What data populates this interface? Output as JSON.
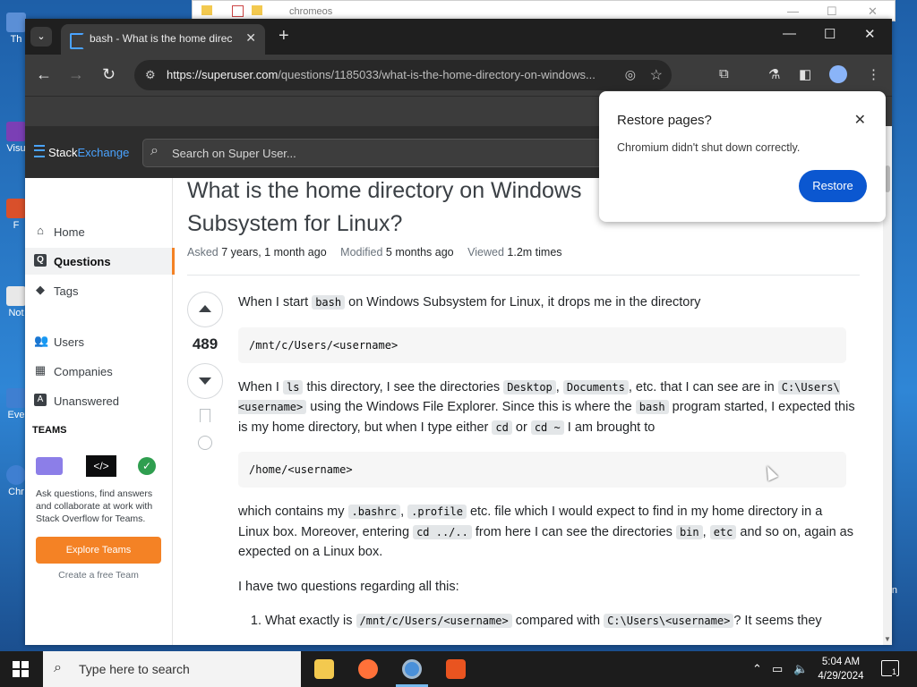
{
  "desktop": {
    "icons": [
      "Th",
      "Visu",
      "F",
      "Not",
      "Eve",
      "Chr"
    ],
    "right_label": "n"
  },
  "explorer": {
    "title": "chromeos"
  },
  "browser": {
    "tab_title": "bash - What is the home direc",
    "url_host": "https://superuser.com",
    "url_path": "/questions/1185033/what-is-the-home-directory-on-windows..."
  },
  "se": {
    "logo_a": "Stack",
    "logo_b": "Exchange",
    "search_placeholder": "Search on Super User..."
  },
  "leftnav": {
    "items": [
      {
        "label": "Home",
        "icon": "house-icon"
      },
      {
        "label": "Questions",
        "icon": "questions-icon"
      },
      {
        "label": "Tags",
        "icon": "tag-icon"
      },
      {
        "label": "Users",
        "icon": "users-icon"
      },
      {
        "label": "Companies",
        "icon": "building-icon"
      },
      {
        "label": "Unanswered",
        "icon": "unanswered-icon"
      }
    ],
    "teams_heading": "TEAMS",
    "teams_text": "Ask questions, find answers and collaborate at work with Stack Overflow for Teams.",
    "teams_button": "Explore Teams",
    "teams_free": "Create a free Team"
  },
  "question": {
    "title": "What is the home directory on Windows Subsystem for Linux?",
    "asked_label": "Asked",
    "asked_value": "7 years, 1 month ago",
    "modified_label": "Modified",
    "modified_value": "5 months ago",
    "viewed_label": "Viewed",
    "viewed_value": "1.2m times",
    "score": "489",
    "p1a": "When I start ",
    "p1code": "bash",
    "p1b": " on Windows Subsystem for Linux, it drops me in the directory",
    "pre1": "/mnt/c/Users/<username>",
    "p2a": "When I ",
    "p2c1": "ls",
    "p2b": " this directory, I see the directories ",
    "p2c2": "Desktop",
    "p2sep": ", ",
    "p2c3": "Documents",
    "p2c": ", etc. that I can see are in ",
    "p2c4": "C:\\Users\\<username>",
    "p2d": " using the Windows File Explorer. Since this is where the ",
    "p2c5": "bash",
    "p2e": " program started, I expected this is my home directory, but when I type either ",
    "p2c6": "cd",
    "p2f": " or ",
    "p2c7": "cd ~",
    "p2g": " I am brought to",
    "pre2": "/home/<username>",
    "p3a": "which contains my ",
    "p3c1": ".bashrc",
    "p3sep": ", ",
    "p3c2": ".profile",
    "p3b": " etc. file which I would expect to find in my home directory in a Linux box. Moreover, entering ",
    "p3c3": "cd ../..",
    "p3c": " from here I can see the directories ",
    "p3c4": "bin",
    "p3sep2": ", ",
    "p3c5": "etc",
    "p3d": " and so on, again as expected on a Linux box.",
    "p4": "I have two questions regarding all this:",
    "li1a": "What exactly is ",
    "li1c1": "/mnt/c/Users/<username>",
    "li1b": " compared with ",
    "li1c2": "C:\\Users\\<username>",
    "li1c": "? It seems they"
  },
  "popup": {
    "title": "Restore pages?",
    "message": "Chromium didn't shut down correctly.",
    "button": "Restore"
  },
  "taskbar": {
    "search": "Type here to search",
    "time": "5:04 AM",
    "date": "4/29/2024",
    "notif_count": "1"
  },
  "colors": {
    "accent": "#f48225",
    "chrome_blue": "#0b57d0",
    "link_blue": "#4aa3ff"
  }
}
